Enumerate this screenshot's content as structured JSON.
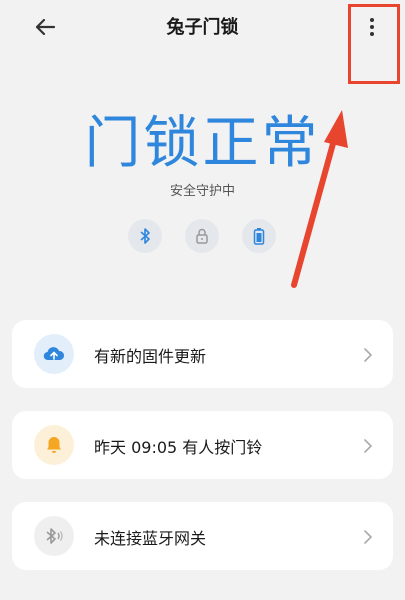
{
  "header": {
    "title": "兔子门锁",
    "back_icon": "arrow-left-icon",
    "more_icon": "more-vertical-icon"
  },
  "status": {
    "headline": "门锁正常",
    "subtitle": "安全守护中",
    "icons": [
      "bluetooth-icon",
      "lock-icon",
      "battery-icon"
    ]
  },
  "cards": [
    {
      "label": "有新的固件更新",
      "icon": "cloud-upload-icon"
    },
    {
      "label": "昨天 09:05 有人按门铃",
      "icon": "bell-icon"
    },
    {
      "label": "未连接蓝牙网关",
      "icon": "bluetooth-off-icon"
    }
  ],
  "colors": {
    "accent": "#2f86dd",
    "callout": "#e8452e",
    "bell": "#f5a623",
    "background": "#f2f2f2"
  }
}
